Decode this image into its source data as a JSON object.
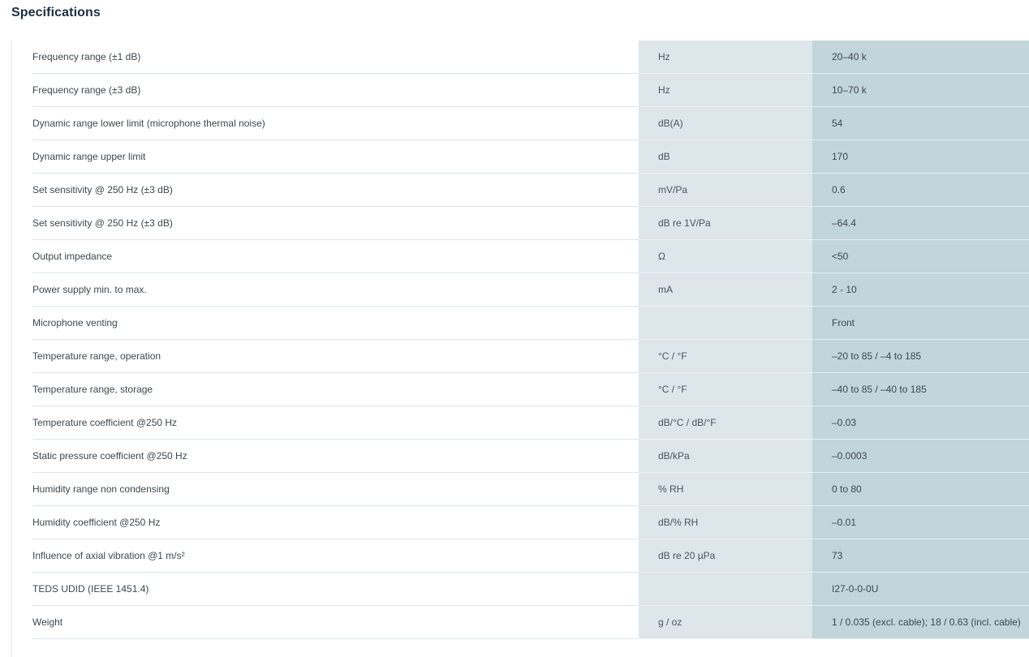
{
  "heading": "Specifications",
  "specs": [
    {
      "name": "Frequency range (±1 dB)",
      "unit": "Hz",
      "value": "20–40 k"
    },
    {
      "name": "Frequency range (±3 dB)",
      "unit": "Hz",
      "value": "10–70 k"
    },
    {
      "name": "Dynamic range lower limit (microphone thermal noise)",
      "unit": "dB(A)",
      "value": "54"
    },
    {
      "name": "Dynamic range upper limit",
      "unit": "dB",
      "value": "170"
    },
    {
      "name": "Set sensitivity @ 250 Hz (±3 dB)",
      "unit": "mV/Pa",
      "value": "0.6"
    },
    {
      "name": "Set sensitivity @ 250 Hz (±3 dB)",
      "unit": "dB re 1V/Pa",
      "value": "–64.4"
    },
    {
      "name": "Output impedance",
      "unit": "Ω",
      "value": "<50"
    },
    {
      "name": "Power supply min. to max.",
      "unit": "mA",
      "value": "2 - 10"
    },
    {
      "name": "Microphone venting",
      "unit": "",
      "value": "Front"
    },
    {
      "name": "Temperature range, operation",
      "unit": "°C / °F",
      "value": "–20 to 85 / –4 to 185"
    },
    {
      "name": "Temperature range, storage",
      "unit": "°C / °F",
      "value": "–40 to 85 / –40 to 185"
    },
    {
      "name": "Temperature coefficient @250 Hz",
      "unit": "dB/°C / dB/°F",
      "value": "–0.03"
    },
    {
      "name": "Static pressure coefficient @250 Hz",
      "unit": "dB/kPa",
      "value": "–0.0003"
    },
    {
      "name": "Humidity range non condensing",
      "unit": "% RH",
      "value": "0 to 80"
    },
    {
      "name": "Humidity coefficient @250 Hz",
      "unit": "dB/% RH",
      "value": "–0.01"
    },
    {
      "name": "Influence of axial vibration @1 m/s²",
      "unit": "dB re 20 µPa",
      "value": "73"
    },
    {
      "name": "TEDS UDID (IEEE 1451.4)",
      "unit": "",
      "value": "I27-0-0-0U"
    },
    {
      "name": "Weight",
      "unit": "g / oz",
      "value": "1 / 0.035 (excl. cable); 18 / 0.63 (incl. cable)"
    }
  ]
}
